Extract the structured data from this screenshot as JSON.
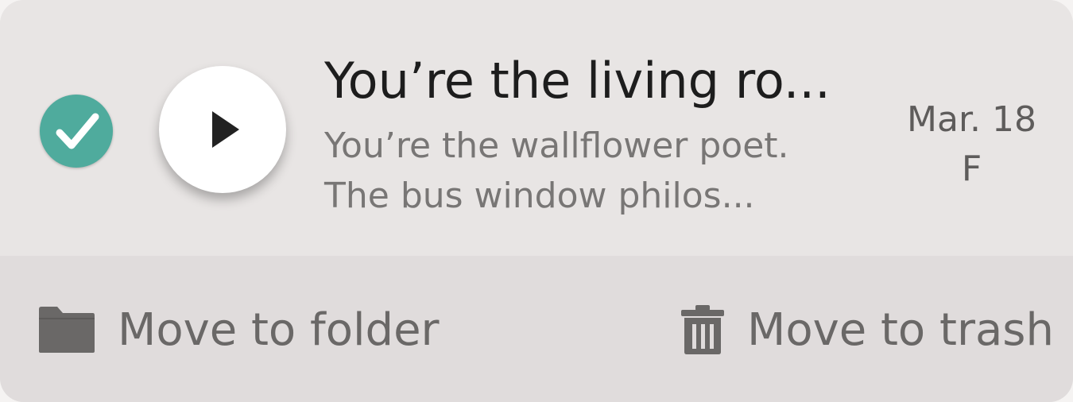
{
  "message": {
    "title": "You’re the living ro...",
    "preview_line1": "You’re the wallflower poet.",
    "preview_line2": "The bus window philos...",
    "date": "Mar. 18",
    "tag": "F",
    "selected": true
  },
  "actions": {
    "move_to_folder": "Move to folder",
    "move_to_trash": "Move to trash"
  },
  "colors": {
    "accent": "#4fab9d",
    "card_top": "#e8e5e4",
    "card_bottom": "#e0dcdc",
    "title": "#1d1d1d",
    "secondary_text": "#787675",
    "icon": "#6a6867"
  },
  "icons": {
    "selected": "check-icon",
    "play": "play-icon",
    "folder": "folder-icon",
    "trash": "trash-icon"
  }
}
